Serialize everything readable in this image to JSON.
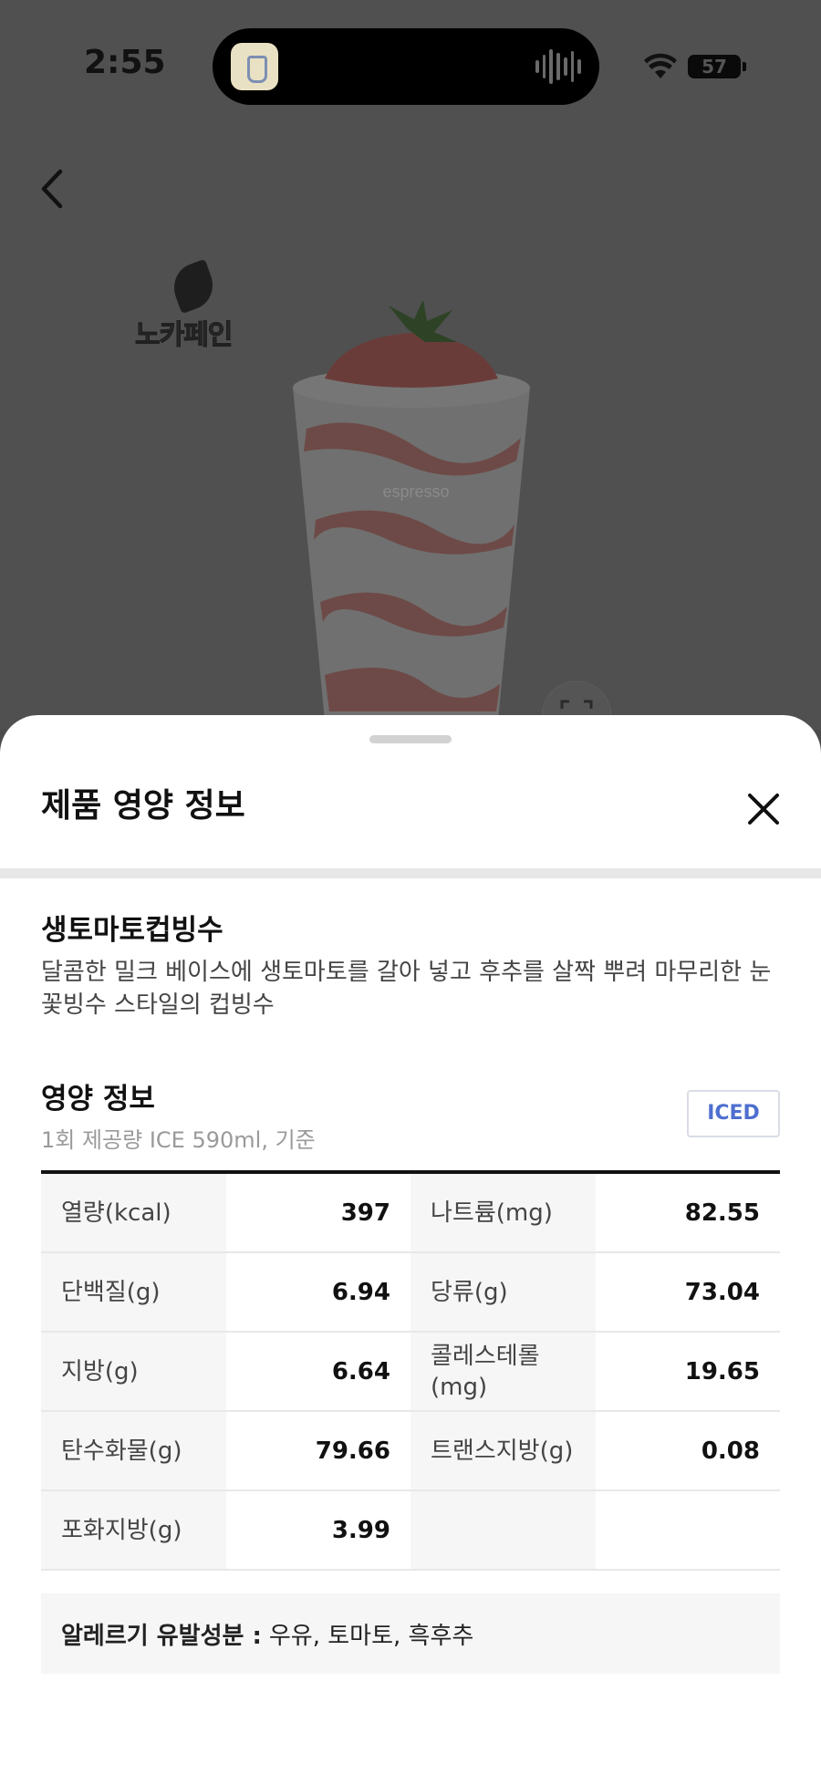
{
  "status_bar": {
    "time": "2:55",
    "battery": "57"
  },
  "background": {
    "brand_name": "노카페인",
    "cup_print": "espresso"
  },
  "sheet": {
    "title": "제품 영양 정보",
    "product_name": "생토마토컵빙수",
    "product_desc": "달콤한 밀크 베이스에 생토마토를 갈아 넣고  후추를 살짝 뿌려 마무리한 눈꽃빙수 스타일의 컵빙수",
    "nutrition_title": "영양 정보",
    "serving": "1회 제공량 ICE 590ml,  기준",
    "temperature_badge": "ICED",
    "rows": [
      {
        "l1": "열량(kcal)",
        "v1": "397",
        "l2": "나트륨(mg)",
        "v2": "82.55"
      },
      {
        "l1": "단백질(g)",
        "v1": "6.94",
        "l2": "당류(g)",
        "v2": "73.04"
      },
      {
        "l1": "지방(g)",
        "v1": "6.64",
        "l2": "콜레스테롤(mg)",
        "v2": "19.65"
      },
      {
        "l1": "탄수화물(g)",
        "v1": "79.66",
        "l2": "트랜스지방(g)",
        "v2": "0.08"
      },
      {
        "l1": "포화지방(g)",
        "v1": "3.99",
        "l2": "",
        "v2": ""
      }
    ],
    "allergy_label": "알레르기 유발성분 :",
    "allergy_value": "우유, 토마토, 흑후추"
  },
  "colors": {
    "accent_badge": "#4e6fd0",
    "overlay": "#505050",
    "table_label_bg": "#f6f6f6"
  },
  "icons": [
    "back-icon",
    "close-icon",
    "wifi-icon",
    "battery-icon",
    "scan-icon",
    "brand-leaf-icon"
  ]
}
